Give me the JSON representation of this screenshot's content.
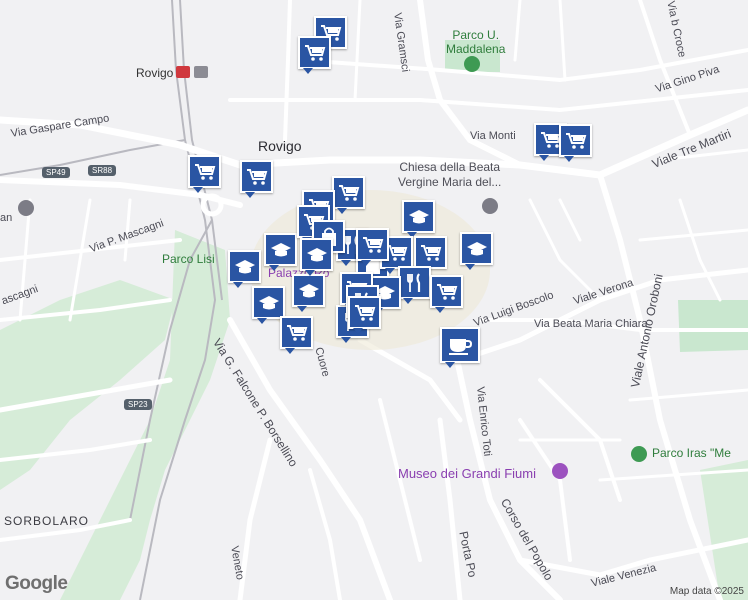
{
  "map": {
    "city_label": "Rovigo",
    "station_label": "Rovigo",
    "attribution": "Map data ©2025",
    "logo": "Google",
    "colors": {
      "background": "#f1f1f3",
      "road": "#ffffff",
      "park": "#c9e7cf",
      "marker": "#2a55a3",
      "rail": "#b9b9c0"
    }
  },
  "streets": {
    "via_gramsci": "Via Gramsci",
    "via_gaspare_campo": "Via Gaspare Campo",
    "via_p_mascagni": "Via P. Mascagni",
    "mascagni_short": "ascagni",
    "via_monti": "Via Monti",
    "viale_tre_martiri": "Viale Tre Martiri",
    "via_gino_piva": "Via Gino Piva",
    "via_b_croce": "Via b Croce",
    "via_luigi_boscolo": "Via Luigi Boscolo",
    "viale_verona": "Viale Verona",
    "via_beata_maria_chiara": "Via Beata Maria Chiara",
    "viale_antonio_oroboni": "Viale Antonio Oroboni",
    "via_enrico_toti": "Via Enrico Toti",
    "via_g_falcone": "Via G. Falcone P. Borsellino",
    "cuore": "Cuore",
    "corso_del_popolo": "Corso del Popolo",
    "porta_po": "Porta Po",
    "viale_venezia": "Viale Venezia",
    "veneto": "Veneto"
  },
  "shields": {
    "sp49": "SP49",
    "sr88": "SR88",
    "sp23": "SP23"
  },
  "places": {
    "parco_maddalena": "Parco U.\nMaddalena",
    "chiesa": "Chiesa della Beata\nVergine Maria del...",
    "parco_lisi": "Parco Lisi",
    "palazzo": "Palazzo Ro",
    "museo": "Museo dei Grandi Fiumi",
    "parco_iras": "Parco Iras \"Me",
    "sorbolaro": "SORBOLARO",
    "left_cut": "an"
  },
  "markers": [
    {
      "type": "cart-icon"
    },
    {
      "type": "cart-icon"
    },
    {
      "type": "cart-icon"
    },
    {
      "type": "cart-icon"
    },
    {
      "type": "cart-icon"
    },
    {
      "type": "cart-icon"
    },
    {
      "type": "cart-icon"
    },
    {
      "type": "cart-icon"
    },
    {
      "type": "school-icon"
    },
    {
      "type": "school-icon"
    },
    {
      "type": "school-icon"
    },
    {
      "type": "school-icon"
    },
    {
      "type": "school-icon"
    },
    {
      "type": "school-icon"
    },
    {
      "type": "cart-icon"
    },
    {
      "type": "restaurant-icon"
    },
    {
      "type": "restaurant-icon"
    },
    {
      "type": "shopping-bag-icon"
    },
    {
      "type": "shopping-bag-icon"
    },
    {
      "type": "cart-icon"
    },
    {
      "type": "cart-icon"
    },
    {
      "type": "restaurant-icon"
    },
    {
      "type": "cart-icon"
    },
    {
      "type": "cart-icon"
    },
    {
      "type": "school-icon"
    },
    {
      "type": "cafe-icon"
    },
    {
      "type": "cart-icon"
    },
    {
      "type": "school-icon"
    },
    {
      "type": "restaurant-icon"
    },
    {
      "type": "cart-icon"
    },
    {
      "type": "cart-icon"
    }
  ]
}
